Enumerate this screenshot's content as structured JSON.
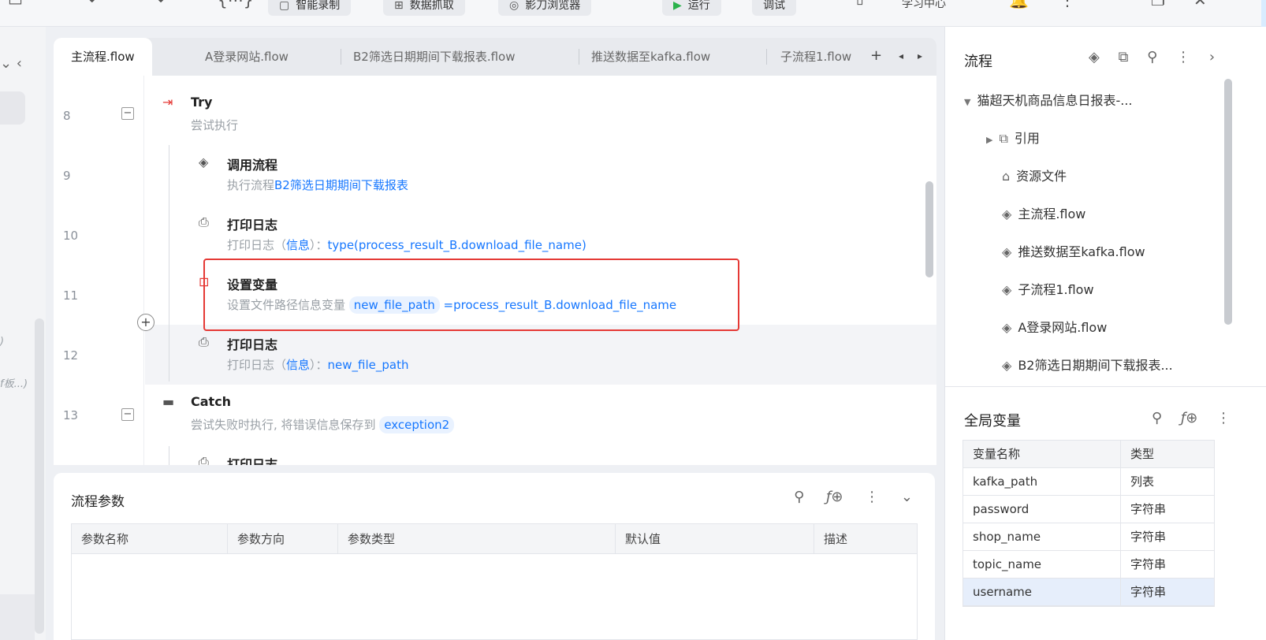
{
  "toolbar": {
    "buttons": [
      "智能录制",
      "数据抓取",
      "影刀浏览器"
    ],
    "run_label": "运行",
    "debug_label": "调试",
    "learn_label": "学习中心"
  },
  "tabs": [
    "主流程.flow",
    "A登录网站.flow",
    "B2筛选日期期间下载报表.flow",
    "推送数据至kafka.flow",
    "子流程1.flow"
  ],
  "left_fragments": [
    ")",
    "f板...)"
  ],
  "editor": {
    "lines": [
      {
        "no": "8",
        "title": "Try",
        "desc": "尝试执行"
      },
      {
        "no": "9",
        "title": "调用流程",
        "desc_prefix": "执行流程",
        "desc_link": "B2筛选日期期间下载报表"
      },
      {
        "no": "10",
        "title": "打印日志",
        "desc_prefix": "打印日志（",
        "desc_level": "信息",
        "desc_mid": "）：",
        "desc_expr": "type(process_result_B.download_file_name)"
      },
      {
        "no": "11",
        "title": "设置变量",
        "desc_prefix": "设置文件路径信息变量",
        "var": "new_file_path",
        "expr": "=process_result_B.download_file_name"
      },
      {
        "no": "12",
        "title": "打印日志",
        "desc_prefix": "打印日志（",
        "desc_level": "信息",
        "desc_mid": "）：",
        "desc_expr": "new_file_path"
      },
      {
        "no": "13",
        "title": "Catch",
        "desc_prefix": "尝试失败时执行, 将错误信息保存到",
        "var": "exception2"
      },
      {
        "no": "",
        "title": "打印日志"
      }
    ]
  },
  "params": {
    "title": "流程参数",
    "columns": [
      "参数名称",
      "参数方向",
      "参数类型",
      "默认值",
      "描述"
    ]
  },
  "right": {
    "flow_title": "流程",
    "root": "猫超天机商品信息日报表-...",
    "nodes": [
      "引用",
      "资源文件",
      "主流程.flow",
      "推送数据至kafka.flow",
      "子流程1.flow",
      "A登录网站.flow",
      "B2筛选日期期间下载报表..."
    ],
    "globals_title": "全局变量",
    "globals_header": [
      "变量名称",
      "类型"
    ],
    "globals": [
      {
        "name": "kafka_path",
        "type": "列表"
      },
      {
        "name": "password",
        "type": "字符串"
      },
      {
        "name": "shop_name",
        "type": "字符串"
      },
      {
        "name": "topic_name",
        "type": "字符串"
      },
      {
        "name": "username",
        "type": "字符串"
      }
    ]
  }
}
